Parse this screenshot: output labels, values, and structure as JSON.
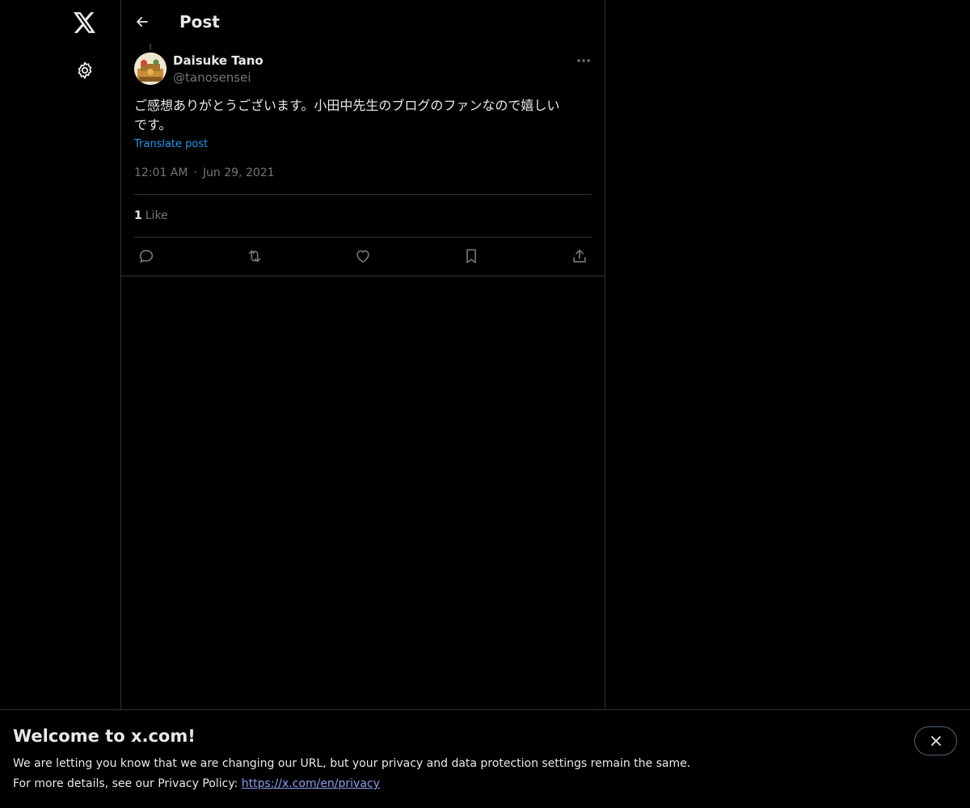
{
  "nav": {
    "logo_icon": "x-logo-icon",
    "settings_icon": "gear-icon"
  },
  "header": {
    "back_icon": "arrow-left-icon",
    "title": "Post"
  },
  "post": {
    "author": {
      "display_name": "Daisuke Tano",
      "handle": "@tanosensei"
    },
    "text": "ご感想ありがとうございます。小田中先生のブログのファンなので嬉しい\nです。",
    "translate_label": "Translate post",
    "time": "12:01 AM",
    "separator": "·",
    "date": "Jun 29, 2021",
    "likes": {
      "count": "1",
      "label": "Like"
    },
    "actions": [
      "reply-icon",
      "repost-icon",
      "like-icon",
      "bookmark-icon",
      "share-icon"
    ]
  },
  "banner": {
    "title": "Welcome to x.com!",
    "line1": "We are letting you know that we are changing our URL, but your privacy and data protection settings remain the same.",
    "line2_prefix": "For more details, see our Privacy Policy: ",
    "link_text": "https://x.com/en/privacy"
  },
  "colors": {
    "background": "#000000",
    "text": "#e7e9ea",
    "muted": "#71767b",
    "accent": "#1d9bf0",
    "border": "#2f3336"
  }
}
